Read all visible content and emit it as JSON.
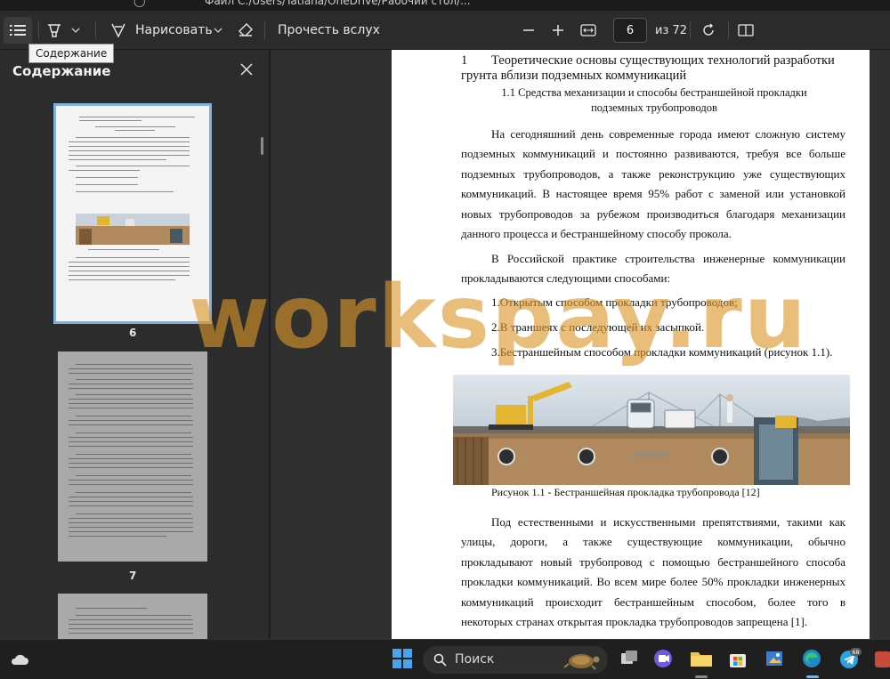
{
  "titlebar": {
    "path": "Файл  C:/Users/Tatiana/OneDrive/Рабочий стол/..."
  },
  "toolbar": {
    "draw_label": "Нарисовать",
    "read_aloud_label": "Прочесть вслух",
    "current_page": "6",
    "total_pages": "из 72",
    "tooltip": "Содержание"
  },
  "sidebar": {
    "title": "Содержание",
    "thumbnails": [
      {
        "label": "6"
      },
      {
        "label": "7"
      }
    ]
  },
  "document": {
    "heading_number": "1",
    "heading_line1": "Теоретические основы существующих технологий разработки",
    "heading_line2": "грунта вблизи подземных коммуникаций",
    "subheading_line1": "1.1 Средства механизации и способы бестраншейной прокладки",
    "subheading_line2": "подземных трубопроводов",
    "para1": "На сегодняшний день современные города имеют сложную систему подземных коммуникаций и постоянно развиваются, требуя все больше подземных трубопроводов, а также реконструкцию уже существующих коммуникаций. В настоящее время 95% работ с заменой или установкой новых трубопроводов за рубежом производиться благодаря механизации данного процесса и бестраншейному способу прокола.",
    "para2": "В Российской практике строительства инженерные коммуникации прокладываются следующими способами:",
    "list": [
      "1.Открытым способом прокладки трубопроводов;",
      "2.В траншеях с последующей их засыпкой.",
      "3.Бестраншейным способом прокладки коммуникаций (рисунок 1.1)."
    ],
    "caption": "Рисунок 1.1 - Бестраншейная прокладка трубопровода [12]",
    "para3": "Под естественными и искусственными препятствиями, такими как улицы, дороги, а также существующие коммуникации, обычно прокладывают новый трубопровод с помощью бестраншейного способа прокладки коммуникаций. Во всем мире более 50% прокладки инженерных коммуникаций происходит бестраншейным способом, более того в некоторых странах открытая прокладка трубопроводов запрещена [1]."
  },
  "watermark": "workspay.ru",
  "taskbar": {
    "search_label": "Поиск",
    "badge": "68"
  },
  "colors": {
    "accent": "#7fb1e0",
    "watermark": "#da9628",
    "background": "#202020"
  }
}
